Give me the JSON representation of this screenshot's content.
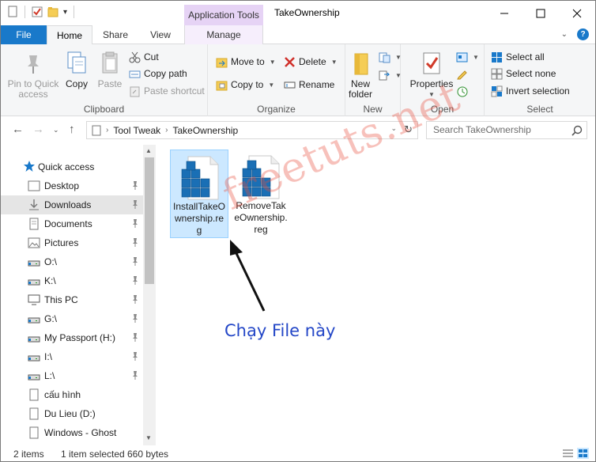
{
  "window": {
    "title": "TakeOwnership"
  },
  "ribbon_tabs": {
    "file": "File",
    "home": "Home",
    "share": "Share",
    "view": "View",
    "context_group": "Application Tools",
    "manage": "Manage"
  },
  "clipboard": {
    "pin_line1": "Pin to Quick",
    "pin_line2": "access",
    "copy": "Copy",
    "paste": "Paste",
    "cut": "Cut",
    "copy_path": "Copy path",
    "paste_shortcut": "Paste shortcut",
    "label": "Clipboard"
  },
  "organize": {
    "move_to": "Move to",
    "copy_to": "Copy to",
    "delete": "Delete",
    "rename": "Rename",
    "label": "Organize"
  },
  "new": {
    "new_line1": "New",
    "new_line2": "folder",
    "label": "New"
  },
  "open": {
    "properties": "Properties",
    "label": "Open"
  },
  "select": {
    "select_all": "Select all",
    "select_none": "Select none",
    "invert": "Invert selection",
    "label": "Select"
  },
  "address": {
    "crumbs": [
      "Tool Tweak",
      "TakeOwnership"
    ]
  },
  "search": {
    "placeholder": "Search TakeOwnership"
  },
  "nav": {
    "quick_access": "Quick access",
    "items": [
      {
        "label": "Desktop",
        "icon": "desktop-icon"
      },
      {
        "label": "Downloads",
        "icon": "downloads-icon"
      },
      {
        "label": "Documents",
        "icon": "documents-icon"
      },
      {
        "label": "Pictures",
        "icon": "pictures-icon"
      },
      {
        "label": "O:\\",
        "icon": "drive-icon"
      },
      {
        "label": "K:\\",
        "icon": "drive-icon"
      },
      {
        "label": "This PC",
        "icon": "computer-icon"
      },
      {
        "label": "G:\\",
        "icon": "drive-icon"
      },
      {
        "label": "My Passport (H:)",
        "icon": "drive-icon"
      },
      {
        "label": "I:\\",
        "icon": "drive-icon"
      },
      {
        "label": "L:\\",
        "icon": "drive-icon"
      },
      {
        "label": "cấu hình",
        "icon": "file-icon"
      },
      {
        "label": "Du Lieu (D:)",
        "icon": "file-icon"
      },
      {
        "label": "Windows - Ghost",
        "icon": "file-icon"
      }
    ]
  },
  "files": [
    {
      "name": "InstallTakeOwnership.reg",
      "selected": true
    },
    {
      "name": "RemoveTakeOwnership.reg",
      "selected": false
    }
  ],
  "overlay": {
    "watermark": "freetuts.net",
    "annotation": "Chạy File này"
  },
  "status": {
    "count": "2 items",
    "selected": "1 item selected",
    "size": "660 bytes"
  },
  "colors": {
    "accent": "#1979ca",
    "context_tab": "#e6d3f5",
    "selection": "#cce8ff",
    "annotation": "#2447c7",
    "watermark": "#e74c3c"
  }
}
